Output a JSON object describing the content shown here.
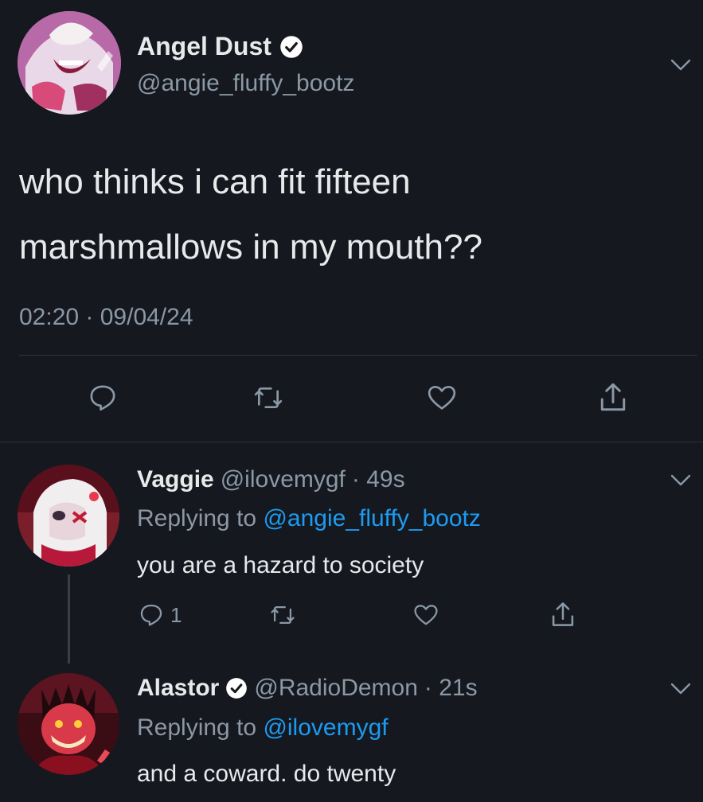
{
  "main_tweet": {
    "author_name": "Angel Dust",
    "author_handle": "@angie_fluffy_bootz",
    "text_line1": "who thinks i can fit fifteen",
    "text_line2": "marshmallows in my mouth??",
    "timestamp": "02:20 · 09/04/24",
    "actions": {
      "reply_icon": "reply-icon",
      "retweet_icon": "retweet-icon",
      "like_icon": "heart-icon",
      "share_icon": "share-icon"
    }
  },
  "replies": [
    {
      "author_name": "Vaggie",
      "author_handle": "@ilovemygf",
      "age": "· 49s",
      "replying_label": "Replying to",
      "replying_to": "@angie_fluffy_bootz",
      "text": "you are a hazard to society",
      "reply_count": "1",
      "verified": false
    },
    {
      "author_name": "Alastor",
      "author_handle": "@RadioDemon",
      "age": "· 21s",
      "replying_label": "Replying to",
      "replying_to": "@ilovemygf",
      "text": "and a coward. do twenty",
      "verified": true
    }
  ],
  "colors": {
    "background": "#15181f",
    "text_primary": "#e7e9ea",
    "text_secondary": "#8b98a5",
    "link": "#1d9bf0",
    "divider": "#2f3336"
  }
}
